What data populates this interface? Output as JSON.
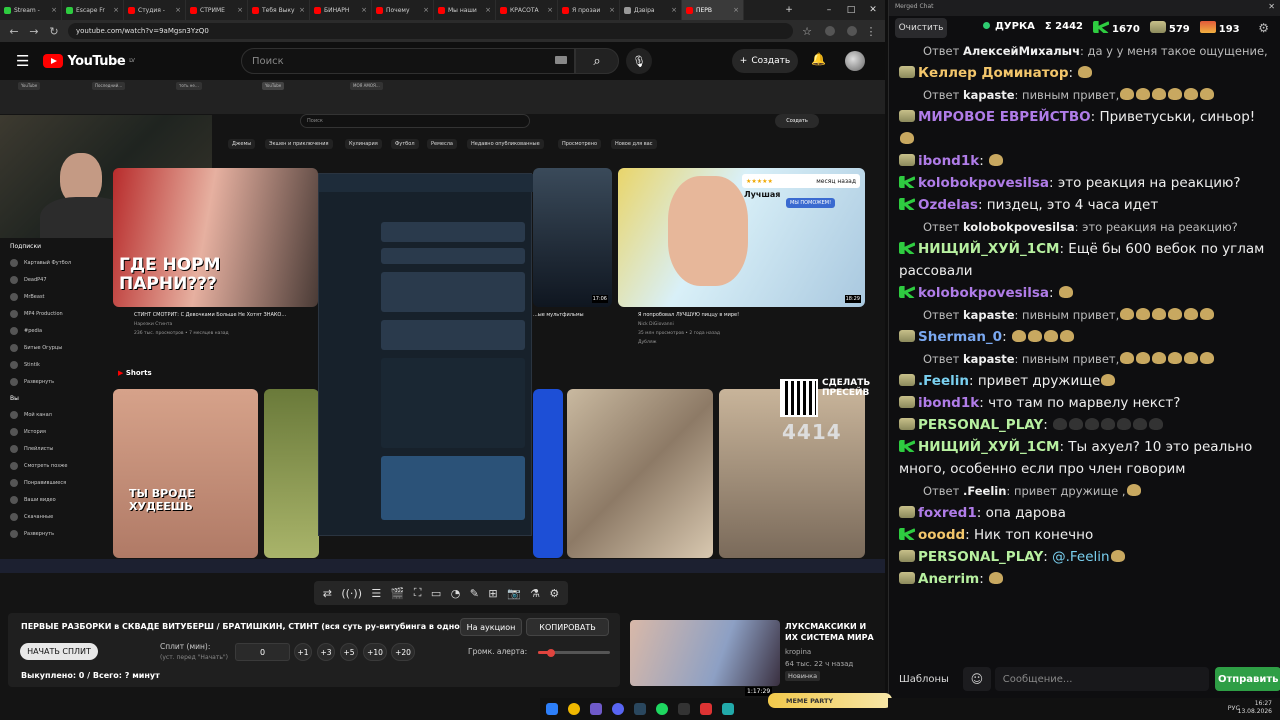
{
  "browser": {
    "tabs": [
      {
        "label": "Stream - ",
        "color": "#2ecc40",
        "active": false
      },
      {
        "label": "Escape Fr",
        "color": "#2ecc40",
        "active": false
      },
      {
        "label": "Студия -",
        "color": "#ff0000",
        "active": false
      },
      {
        "label": "СТРИМЕ",
        "color": "#ff0000",
        "active": false
      },
      {
        "label": "Тебя Выку",
        "color": "#ff0000",
        "active": false
      },
      {
        "label": "БИНАРН",
        "color": "#ff0000",
        "active": false
      },
      {
        "label": "Почему",
        "color": "#ff0000",
        "active": false
      },
      {
        "label": "Мы наши",
        "color": "#ff0000",
        "active": false
      },
      {
        "label": "КРАСОТА",
        "color": "#ff0000",
        "active": false
      },
      {
        "label": "Я прозаи",
        "color": "#ff0000",
        "active": false
      },
      {
        "label": "Дзвіра",
        "color": "#999999",
        "active": false
      },
      {
        "label": "ПЕРВ",
        "color": "#ff0000",
        "active": true
      }
    ],
    "url": "youtube.com/watch?v=9aMgsn3YzQ0"
  },
  "youtube": {
    "logo_text": "YouTube",
    "logo_region": "LV",
    "search_placeholder": "Поиск",
    "create_label": "Создать"
  },
  "video": {
    "inner_search_placeholder": "Поиск",
    "inner_create_label": "Создать",
    "chips": [
      "Джемы",
      "Экшен и приключения",
      "Кулинария",
      "Футбол",
      "Ремесла",
      "Недавно опубликованные",
      "Просмотрено",
      "Новое для вас"
    ],
    "sidebar_subs_header": "Подписки",
    "sidebar_subs": [
      "Картавый Футбол",
      "DeadP47",
      "MrBeast",
      "MP4 Production",
      "#pedia",
      "Битые Огурцы",
      "Stintik",
      "Развернуть"
    ],
    "sidebar_you_header": "Вы",
    "sidebar_you": [
      "Мой канал",
      "История",
      "Плейлисты",
      "Смотреть позже",
      "Понравившиеся",
      "Ваши видео",
      "Скачанные",
      "Развернуть"
    ],
    "thumb1_caption": "ГДЕ НОРМ ПАРНИ???",
    "thumb1_title": "СТИНТ СМОТРИТ: С Девочками Больше Не Хотят ЗНАКО...",
    "thumb1_channel": "Нарезки Стинта",
    "thumb1_meta": "236 тыс. просмотров • 7 месяцев назад",
    "thumb2_title": "...ые мультфильмы",
    "thumb2_duration": "17:06",
    "thumb3_badge_stars": "★★★★★",
    "thumb3_badge_text": "месяц назад",
    "thumb3_caption": "Лучшая",
    "thumb3_sub": "МЫ ПОМОЖЕМ!",
    "thumb3_duration": "18:29",
    "thumb3_title": "Я попробовал ЛУЧШУЮ пиццу в мире!",
    "thumb3_channel": "Nick DiGiovanni",
    "thumb3_meta": "35 млн просмотров • 2 года назад",
    "thumb3_tag": "Дубляж",
    "shorts_label": "Shorts",
    "short1_caption": "ТЫ ВРОДЕ ХУДЕЕШЬ",
    "cta_text": "СДЕЛАТЬ ПРЕСЕЙВ",
    "counter": "4414"
  },
  "controls": {
    "stream_title": "ПЕРВЫЕ РАЗБОРКИ в СКВАДЕ ВИТУБЕРШ / БРАТИШКИН, СТИНТ (вся суть ру-витубинга в одном видео)",
    "auction_label": "На аукцион",
    "copy_label": "КОПИРОВАТЬ",
    "start_split_label": "НАЧАТЬ СПЛИТ",
    "split_label": "Сплит (мин):",
    "split_sub": "(уст. перед \"Начать\")",
    "split_value": "0",
    "increments": [
      "+1",
      "+3",
      "+5",
      "+10",
      "+20"
    ],
    "alert_volume_label": "Громк. алерта:",
    "alert_volume": 0.18,
    "bought_text": "Выкуплено: 0 / Всего: ? минут"
  },
  "recommended": {
    "title": "ЛУКСМАКСИКИ И ИХ СИСТЕМА МИРА",
    "channel": "kropina",
    "meta": "64 тыс. 22 ч назад",
    "tag": "Новинка",
    "duration": "1:17:29"
  },
  "chat": {
    "window_title": "Merged Chat",
    "clear_label": "Очистить",
    "stat_live": "ДУРКА",
    "stat_sum": "Σ 2442",
    "stat_k": "1670",
    "stat_yt": "579",
    "stat_fire": "193",
    "messages": [
      {
        "type": "reply",
        "prefix": "Ответ",
        "nick": "АлексейМихалыч",
        "text": "да у у меня такое ощущение, ч...",
        "color": "#f0f0f0"
      },
      {
        "type": "msg",
        "src": "yt",
        "nick": "Келлер Доминатор",
        "text": "",
        "color": "#f3c66b",
        "emotes": 1
      },
      {
        "type": "reply",
        "prefix": "Ответ",
        "nick": "kapaste",
        "text": "пивным привет,",
        "color": "#f0f0f0",
        "emotes": 6
      },
      {
        "type": "msg",
        "src": "yt",
        "nick": "МИРОВОЕ ЕВРЕЙСТВО",
        "text": "Приветуськи, синьор!",
        "color": "#b07ce8",
        "emotes": 1
      },
      {
        "type": "msg",
        "src": "yt",
        "nick": "ibond1k",
        "text": "",
        "color": "#b07ce8",
        "emotes": 1
      },
      {
        "type": "msg",
        "src": "tw",
        "nick": "kolobokpovesilsa",
        "text": "это реакция на реакцию?",
        "color": "#b07ce8"
      },
      {
        "type": "msg",
        "src": "tw",
        "nick": "Ozdelas",
        "text": "пиздец, это 4 часа идет",
        "color": "#b07ce8"
      },
      {
        "type": "reply",
        "prefix": "Ответ",
        "nick": "kolobokpovesilsa",
        "text": "это реакция на реакцию?",
        "color": "#f0f0f0"
      },
      {
        "type": "msg",
        "src": "tw",
        "nick": "НИЩИЙ_ХУЙ_1СМ",
        "text": "Ещё бы 600 вебок по углам рассовали",
        "color": "#b7f0a0"
      },
      {
        "type": "msg",
        "src": "tw",
        "nick": "kolobokpovesilsa",
        "text": "",
        "color": "#b07ce8",
        "emotes": 1
      },
      {
        "type": "reply",
        "prefix": "Ответ",
        "nick": "kapaste",
        "text": "пивным привет,",
        "color": "#f0f0f0",
        "emotes": 6
      },
      {
        "type": "msg",
        "src": "yt",
        "nick": "Sherman_0",
        "text": "",
        "color": "#7aa8f0",
        "emotes": 4
      },
      {
        "type": "reply",
        "prefix": "Ответ",
        "nick": "kapaste",
        "text": "пивным привет,",
        "color": "#f0f0f0",
        "emotes": 6
      },
      {
        "type": "msg",
        "src": "yt",
        "nick": ".Feelin",
        "text": "привет дружище",
        "color": "#7ad0f0",
        "emotes": 1
      },
      {
        "type": "msg",
        "src": "yt",
        "nick": "ibond1k",
        "text": "что там по марвелу некст?",
        "color": "#b07ce8"
      },
      {
        "type": "msg",
        "src": "yt",
        "nick": "PERSONAL_PLAY",
        "text": "",
        "color": "#b7f0a0",
        "emotes": 7
      },
      {
        "type": "msg",
        "src": "tw",
        "nick": "НИЩИЙ_ХУЙ_1СМ",
        "text": "Ты ахуел? 10 это реально много, особенно если про член говорим",
        "color": "#b7f0a0"
      },
      {
        "type": "reply",
        "prefix": "Ответ",
        "nick": ".Feelin",
        "text": "привет дружище ,",
        "color": "#f0f0f0",
        "emotes": 1
      },
      {
        "type": "msg",
        "src": "yt",
        "nick": "foxred1",
        "text": "опа дарова",
        "color": "#b07ce8"
      },
      {
        "type": "msg",
        "src": "tw",
        "nick": "ooodd",
        "text": "Ник топ конечно",
        "color": "#f3c66b"
      },
      {
        "type": "msg",
        "src": "yt",
        "nick": "PERSONAL_PLAY",
        "text": "@.Feelin",
        "color": "#b7f0a0",
        "emotes": 1
      },
      {
        "type": "msg",
        "src": "yt",
        "nick": "Anerrim",
        "text": "",
        "color": "#b7f0a0",
        "emotes": 1
      }
    ],
    "templates_label": "Шаблоны",
    "input_placeholder": "Сообщение...",
    "send_label": "Отправить"
  },
  "os": {
    "lang": "РУС",
    "time": "16:27",
    "date": "13.08.2026",
    "pill_text": "MEME PARTY"
  },
  "colors": {
    "accent_red": "#ff0000",
    "send_green": "#2e9e45",
    "twitch_green": "#2ecc40"
  }
}
